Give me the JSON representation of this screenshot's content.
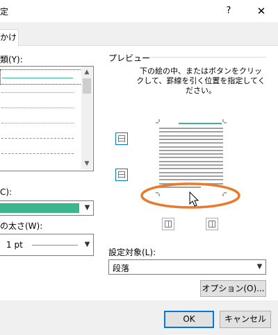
{
  "window": {
    "title": "定",
    "help_glyph": "?",
    "close_glyph": "✕"
  },
  "tabs": [
    {
      "label": "かけ"
    }
  ],
  "left": {
    "style_label": "類(Y):",
    "line_styles": [
      {
        "kind": "solid",
        "color": "#3cb48c",
        "selected": true
      },
      {
        "kind": "dotted",
        "color": "#3cb48c"
      },
      {
        "kind": "dotted",
        "color": "#3cb48c"
      },
      {
        "kind": "dotted",
        "color": "#3cb48c"
      },
      {
        "kind": "dashed",
        "color": "#3cb48c"
      },
      {
        "kind": "dashdot",
        "color": "#3cb48c"
      }
    ],
    "color_label": "C):",
    "color_value": "#3cb48c",
    "width_label": "の太さ(W):",
    "width_value": "1 pt"
  },
  "preview": {
    "title": "プレビュー",
    "hint": "下の絵の中、またはボタンをクリックして、罫線を引く位置を指定してください。",
    "accent": "#e97a2c"
  },
  "apply": {
    "label": "設定対象(L):",
    "value": "段落"
  },
  "options_button": "オプション(O)...",
  "ok_button": "OK",
  "cancel_button": "キャンセル"
}
